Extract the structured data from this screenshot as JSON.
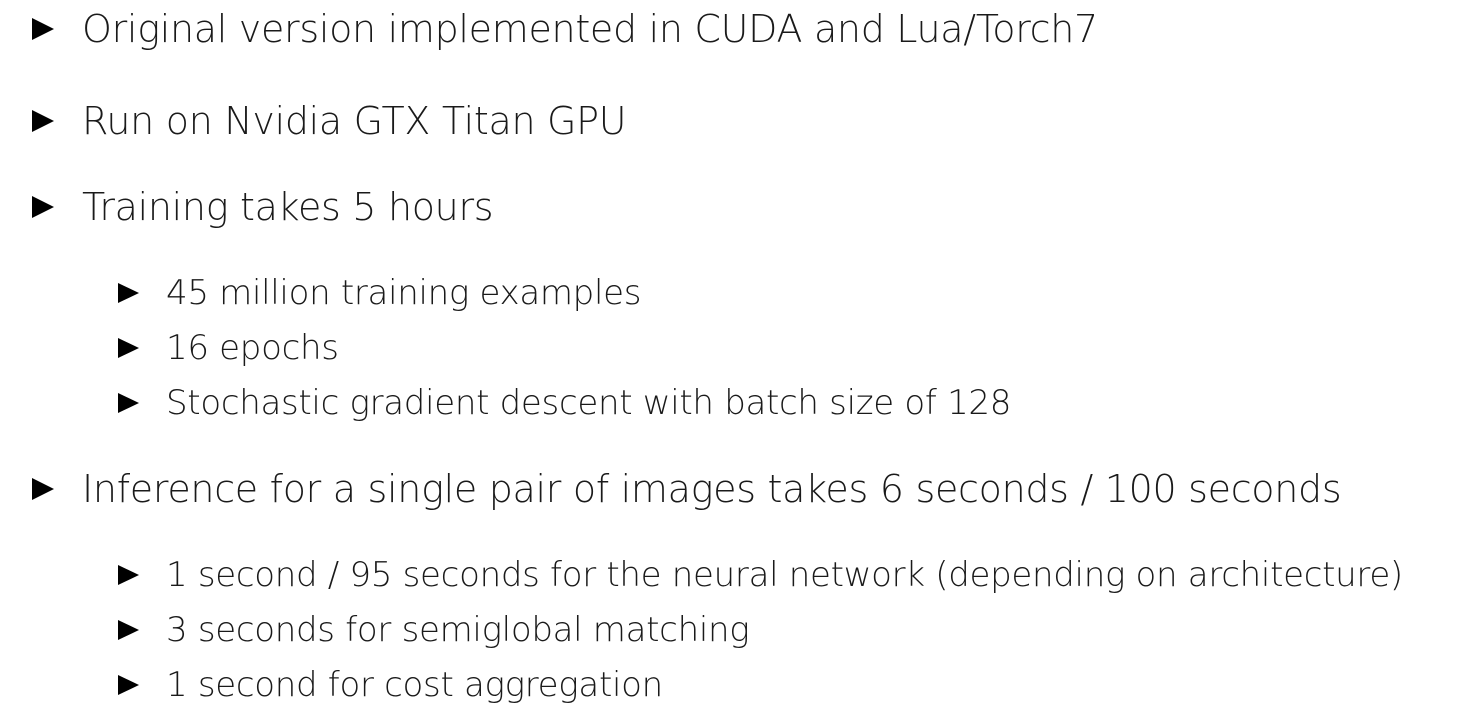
{
  "bullets": [
    {
      "text": "Original version implemented in CUDA and Lua/Torch7"
    },
    {
      "text": "Run on Nvidia GTX Titan GPU"
    },
    {
      "text": "Training takes 5 hours"
    },
    {
      "text": "45 million training examples"
    },
    {
      "text": "16 epochs"
    },
    {
      "text": "Stochastic gradient descent with batch size of 128"
    },
    {
      "text": "Inference for a single pair of images takes 6 seconds / 100 seconds"
    },
    {
      "text": "1 second / 95 seconds for the neural network (depending on architecture)"
    },
    {
      "text": "3 seconds for semiglobal matching"
    },
    {
      "text": "1 second for cost aggregation"
    }
  ],
  "icons": {
    "bullet": "triangle-right-icon"
  },
  "colors": {
    "text": "#1a1a1a",
    "bullet": "#000000",
    "background": "#ffffff"
  }
}
